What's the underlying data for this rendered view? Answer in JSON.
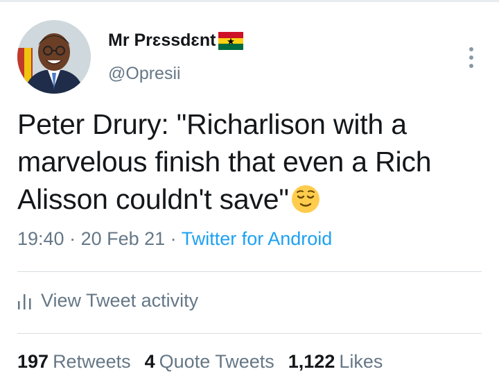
{
  "tweet": {
    "author": {
      "display_name": "Mr Prɛssdɛnt",
      "flag_icon": "ghana-flag-icon",
      "handle": "@Opresii"
    },
    "more_icon": "vertical-ellipsis-icon",
    "text_lines": [
      "Peter Drury: \"Richarlison with a",
      "marvelous finish that even a Rich",
      "Alisson couldn't save\""
    ],
    "emoji_icon": "relieved-face-emoji",
    "time": "19:40",
    "date": "20 Feb 21",
    "source": "Twitter for Android",
    "separator": " · ",
    "activity_label": "View Tweet activity",
    "activity_icon": "bar-chart-icon",
    "stats": {
      "retweets": {
        "count": "197",
        "label": "Retweets"
      },
      "quotes": {
        "count": "4",
        "label": "Quote Tweets"
      },
      "likes": {
        "count": "1,122",
        "label": "Likes"
      }
    }
  },
  "colors": {
    "text_primary": "#14171a",
    "text_secondary": "#657786",
    "link": "#1da1f2",
    "divider": "#d9dee2"
  }
}
